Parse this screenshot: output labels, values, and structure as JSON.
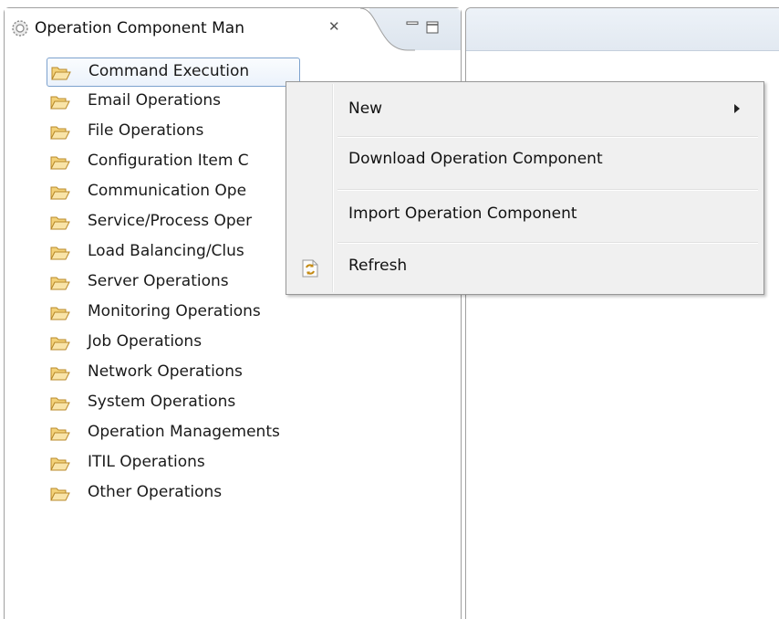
{
  "view": {
    "title": "Operation Component Man",
    "close_glyph": "✕"
  },
  "tree": {
    "items": [
      {
        "label": "Command Execution",
        "selected": true
      },
      {
        "label": "Email Operations"
      },
      {
        "label": "File Operations"
      },
      {
        "label": "Configuration Item C"
      },
      {
        "label": "Communication Ope"
      },
      {
        "label": "Service/Process Oper"
      },
      {
        "label": "Load Balancing/Clus"
      },
      {
        "label": "Server Operations"
      },
      {
        "label": "Monitoring Operations"
      },
      {
        "label": "Job Operations"
      },
      {
        "label": "Network Operations"
      },
      {
        "label": "System Operations"
      },
      {
        "label": "Operation Managements"
      },
      {
        "label": "ITIL Operations"
      },
      {
        "label": "Other Operations"
      }
    ]
  },
  "context_menu": {
    "items": [
      {
        "label": "New",
        "has_submenu": true
      },
      {
        "label": "Download Operation Component"
      },
      {
        "label": "Import Operation Component"
      },
      {
        "label": "Refresh",
        "icon": "refresh-icon"
      }
    ]
  },
  "icons": {
    "tab": "gear-icon",
    "tree_item": "folder-open-icon",
    "minimize": "minimize-icon",
    "maximize": "maximize-icon"
  },
  "colors": {
    "selection_border": "#7da2ce",
    "menu_background": "#f0f0f0",
    "folder_fill": "#f3d27a",
    "folder_stroke": "#b88a2a"
  }
}
